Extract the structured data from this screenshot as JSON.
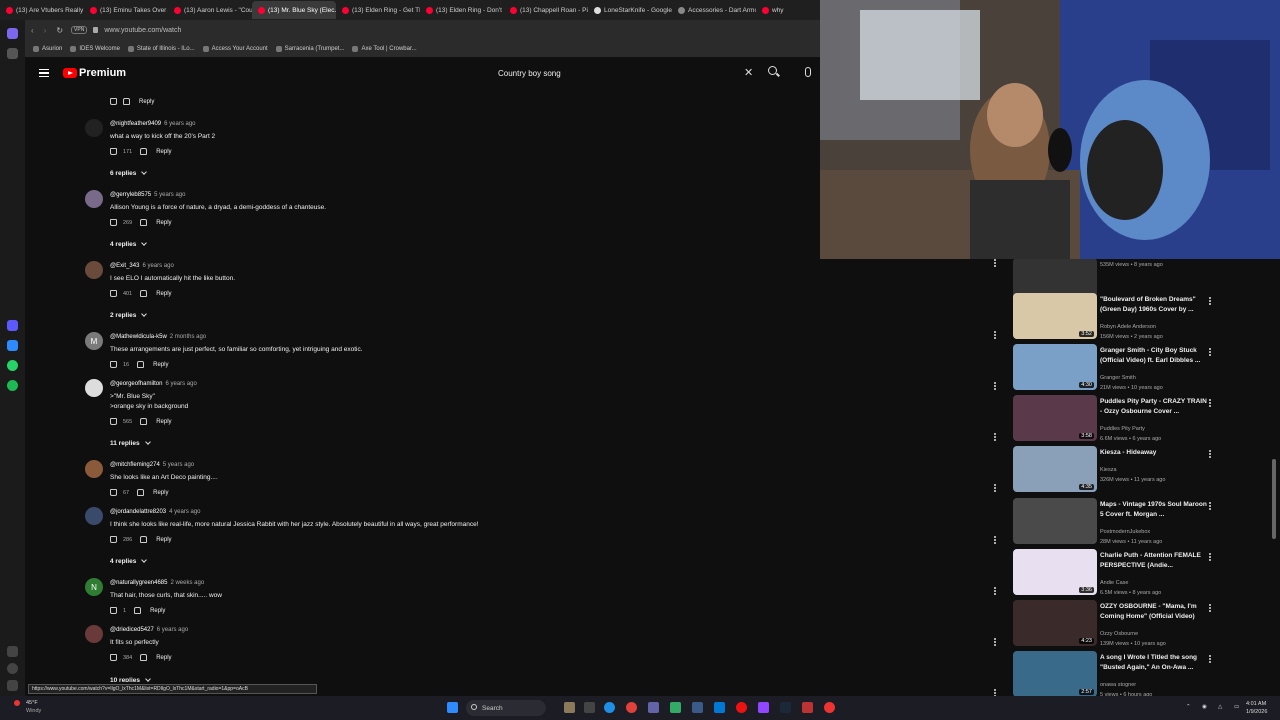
{
  "browser": {
    "tabs": [
      {
        "label": "(13) Are Vtubers Really th..."
      },
      {
        "label": "(13) Eminu Takes Over Am..."
      },
      {
        "label": "(13) Aaron Lewis - \"Count..."
      },
      {
        "label": "(13) Mr. Blue Sky (Elec...",
        "active": true
      },
      {
        "label": "(13) Elden Ring - Get Thes..."
      },
      {
        "label": "(13) Elden Ring - Don't M..."
      },
      {
        "label": "(13) Chappell Roan - Pink..."
      },
      {
        "label": "LoneStarKnife - Google S..."
      },
      {
        "label": "Accessories - Dart Armou..."
      },
      {
        "label": "why"
      }
    ],
    "url": "www.youtube.com/watch",
    "bookmarks": [
      "Asurion",
      "IDES Welcome",
      "State of Illinois - ILo...",
      "Access Your Account",
      "Sarracenia (Trumpet...",
      "Axe Tool | Crowbar..."
    ]
  },
  "youtube": {
    "brand": "Premium",
    "search_value": "Country boy song"
  },
  "comments": {
    "top_partial": {
      "likes": "",
      "reply": "Reply"
    },
    "items": [
      {
        "author": "@nightfeather9409",
        "age": "6 years ago",
        "text": [
          "what a way to kick off the 20's Part 2"
        ],
        "likes": "171",
        "reply": "Reply",
        "replies": "6 replies"
      },
      {
        "author": "@gerryleb8575",
        "age": "5 years ago",
        "text": [
          "Allison Young is a force of nature, a dryad, a demi-goddess of a chanteuse."
        ],
        "likes": "269",
        "reply": "Reply",
        "replies": "4 replies"
      },
      {
        "author": "@Exit_343",
        "age": "6 years ago",
        "text": [
          "I see ELO I automatically hit the like button."
        ],
        "likes": "401",
        "reply": "Reply",
        "replies": "2 replies"
      },
      {
        "author": "@Mathewldicula-k5w",
        "age": "2 months ago",
        "text": [
          "These arrangements are just perfect, so familiar so comforting, yet intriguing and exotic."
        ],
        "likes": "16",
        "reply": "Reply",
        "replies": ""
      },
      {
        "author": "@georgeofhamilton",
        "age": "6 years ago",
        "text": [
          ">\"Mr. Blue Sky\"",
          ">orange sky in background"
        ],
        "likes": "565",
        "reply": "Reply",
        "replies": "11 replies"
      },
      {
        "author": "@mitchfleming274",
        "age": "5 years ago",
        "text": [
          "She looks like an Art Deco painting...."
        ],
        "likes": "67",
        "reply": "Reply",
        "replies": ""
      },
      {
        "author": "@jordandelattre8203",
        "age": "4 years ago",
        "text": [
          "I think she looks like real-life, more natural Jessica Rabbit with her jazz style. Absolutely beautiful in all ways, great performance!"
        ],
        "likes": "286",
        "reply": "Reply",
        "replies": "4 replies"
      },
      {
        "author": "@naturallygreen4685",
        "age": "2 weeks ago",
        "text": [
          "That hair, those curls, that skin..... wow"
        ],
        "likes": "1",
        "reply": "Reply",
        "replies": ""
      },
      {
        "author": "@driediced5427",
        "age": "6 years ago",
        "text": [
          "It fits so perfectly"
        ],
        "likes": "384",
        "reply": "Reply",
        "replies": "10 replies"
      }
    ]
  },
  "sidebar": {
    "items": [
      {
        "title": "",
        "channel": "",
        "meta": "535M views • 8 years ago",
        "duration": "8:07"
      },
      {
        "title": "\"Boulevard of Broken Dreams\" (Green Day) 1960s Cover by ...",
        "channel": "Robyn Adele Anderson",
        "meta": "156M views • 2 years ago",
        "duration": "3:52"
      },
      {
        "title": "Granger Smith - City Boy Stuck (Official Video) ft. Earl Dibbles ...",
        "channel": "Granger Smith",
        "meta": "21M views • 10 years ago",
        "duration": "4:30"
      },
      {
        "title": "Puddles Pity Party - CRAZY TRAIN - Ozzy Osbourne Cover ...",
        "channel": "Puddles Pity Party",
        "meta": "6.6M views • 6 years ago",
        "duration": "3:58"
      },
      {
        "title": "Kiesza - Hideaway",
        "channel": "Kiesza",
        "meta": "326M views • 11 years ago",
        "duration": "4:35"
      },
      {
        "title": "Maps - Vintage 1970s Soul Maroon 5 Cover ft. Morgan ...",
        "channel": "PostmodernJukebox",
        "meta": "28M views • 11 years ago",
        "duration": ""
      },
      {
        "title": "Charlie Puth - Attention FEMALE PERSPECTIVE (Andie...",
        "channel": "Andie Case",
        "meta": "6.5M views • 8 years ago",
        "duration": "3:36"
      },
      {
        "title": "OZZY OSBOURNE - \"Mama, I'm Coming Home\" (Official Video)",
        "channel": "Ozzy Osbourne",
        "meta": "139M views • 10 years ago",
        "duration": "4:23"
      },
      {
        "title": "A song I Wrote I Titled the song \"Busted Again,\" An On-Awa ...",
        "channel": "onawa stogner",
        "meta": "5 views • 6 hours ago",
        "duration": "2:57"
      }
    ]
  },
  "status_url": "https://www.youtube.com/watch?v=IlgO_lxThc1M&list=RDIlgO_lxThc1M&start_radio=1&pp=oAcB",
  "taskbar": {
    "weather_temp": "45°F",
    "weather_desc": "Windy",
    "search_placeholder": "Search",
    "time": "4:01 AM",
    "date": "1/9/2026"
  },
  "colors": {
    "accent": "#ff0000",
    "bg": "#0f0f0f",
    "taskbar": "#1c1c24"
  }
}
